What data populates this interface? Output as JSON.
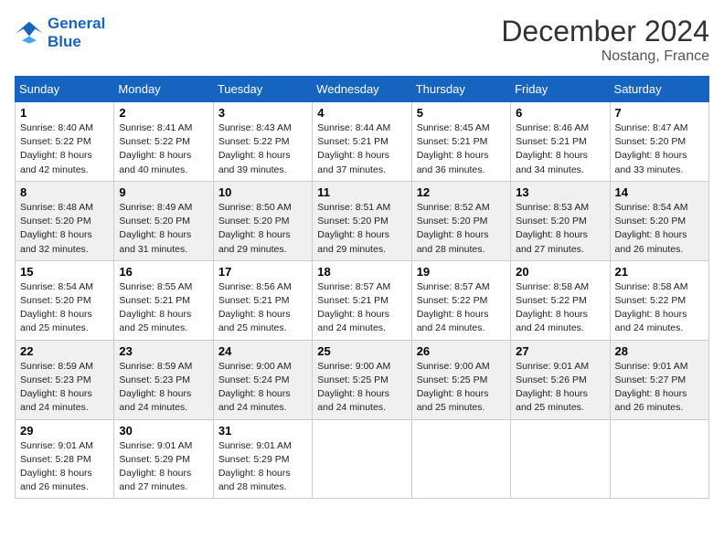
{
  "header": {
    "logo_line1": "General",
    "logo_line2": "Blue",
    "month_title": "December 2024",
    "location": "Nostang, France"
  },
  "days_of_week": [
    "Sunday",
    "Monday",
    "Tuesday",
    "Wednesday",
    "Thursday",
    "Friday",
    "Saturday"
  ],
  "weeks": [
    [
      {
        "day": "1",
        "sunrise": "8:40 AM",
        "sunset": "5:22 PM",
        "daylight": "8 hours and 42 minutes."
      },
      {
        "day": "2",
        "sunrise": "8:41 AM",
        "sunset": "5:22 PM",
        "daylight": "8 hours and 40 minutes."
      },
      {
        "day": "3",
        "sunrise": "8:43 AM",
        "sunset": "5:22 PM",
        "daylight": "8 hours and 39 minutes."
      },
      {
        "day": "4",
        "sunrise": "8:44 AM",
        "sunset": "5:21 PM",
        "daylight": "8 hours and 37 minutes."
      },
      {
        "day": "5",
        "sunrise": "8:45 AM",
        "sunset": "5:21 PM",
        "daylight": "8 hours and 36 minutes."
      },
      {
        "day": "6",
        "sunrise": "8:46 AM",
        "sunset": "5:21 PM",
        "daylight": "8 hours and 34 minutes."
      },
      {
        "day": "7",
        "sunrise": "8:47 AM",
        "sunset": "5:20 PM",
        "daylight": "8 hours and 33 minutes."
      }
    ],
    [
      {
        "day": "8",
        "sunrise": "8:48 AM",
        "sunset": "5:20 PM",
        "daylight": "8 hours and 32 minutes."
      },
      {
        "day": "9",
        "sunrise": "8:49 AM",
        "sunset": "5:20 PM",
        "daylight": "8 hours and 31 minutes."
      },
      {
        "day": "10",
        "sunrise": "8:50 AM",
        "sunset": "5:20 PM",
        "daylight": "8 hours and 29 minutes."
      },
      {
        "day": "11",
        "sunrise": "8:51 AM",
        "sunset": "5:20 PM",
        "daylight": "8 hours and 29 minutes."
      },
      {
        "day": "12",
        "sunrise": "8:52 AM",
        "sunset": "5:20 PM",
        "daylight": "8 hours and 28 minutes."
      },
      {
        "day": "13",
        "sunrise": "8:53 AM",
        "sunset": "5:20 PM",
        "daylight": "8 hours and 27 minutes."
      },
      {
        "day": "14",
        "sunrise": "8:54 AM",
        "sunset": "5:20 PM",
        "daylight": "8 hours and 26 minutes."
      }
    ],
    [
      {
        "day": "15",
        "sunrise": "8:54 AM",
        "sunset": "5:20 PM",
        "daylight": "8 hours and 25 minutes."
      },
      {
        "day": "16",
        "sunrise": "8:55 AM",
        "sunset": "5:21 PM",
        "daylight": "8 hours and 25 minutes."
      },
      {
        "day": "17",
        "sunrise": "8:56 AM",
        "sunset": "5:21 PM",
        "daylight": "8 hours and 25 minutes."
      },
      {
        "day": "18",
        "sunrise": "8:57 AM",
        "sunset": "5:21 PM",
        "daylight": "8 hours and 24 minutes."
      },
      {
        "day": "19",
        "sunrise": "8:57 AM",
        "sunset": "5:22 PM",
        "daylight": "8 hours and 24 minutes."
      },
      {
        "day": "20",
        "sunrise": "8:58 AM",
        "sunset": "5:22 PM",
        "daylight": "8 hours and 24 minutes."
      },
      {
        "day": "21",
        "sunrise": "8:58 AM",
        "sunset": "5:22 PM",
        "daylight": "8 hours and 24 minutes."
      }
    ],
    [
      {
        "day": "22",
        "sunrise": "8:59 AM",
        "sunset": "5:23 PM",
        "daylight": "8 hours and 24 minutes."
      },
      {
        "day": "23",
        "sunrise": "8:59 AM",
        "sunset": "5:23 PM",
        "daylight": "8 hours and 24 minutes."
      },
      {
        "day": "24",
        "sunrise": "9:00 AM",
        "sunset": "5:24 PM",
        "daylight": "8 hours and 24 minutes."
      },
      {
        "day": "25",
        "sunrise": "9:00 AM",
        "sunset": "5:25 PM",
        "daylight": "8 hours and 24 minutes."
      },
      {
        "day": "26",
        "sunrise": "9:00 AM",
        "sunset": "5:25 PM",
        "daylight": "8 hours and 25 minutes."
      },
      {
        "day": "27",
        "sunrise": "9:01 AM",
        "sunset": "5:26 PM",
        "daylight": "8 hours and 25 minutes."
      },
      {
        "day": "28",
        "sunrise": "9:01 AM",
        "sunset": "5:27 PM",
        "daylight": "8 hours and 26 minutes."
      }
    ],
    [
      {
        "day": "29",
        "sunrise": "9:01 AM",
        "sunset": "5:28 PM",
        "daylight": "8 hours and 26 minutes."
      },
      {
        "day": "30",
        "sunrise": "9:01 AM",
        "sunset": "5:29 PM",
        "daylight": "8 hours and 27 minutes."
      },
      {
        "day": "31",
        "sunrise": "9:01 AM",
        "sunset": "5:29 PM",
        "daylight": "8 hours and 28 minutes."
      },
      null,
      null,
      null,
      null
    ]
  ]
}
